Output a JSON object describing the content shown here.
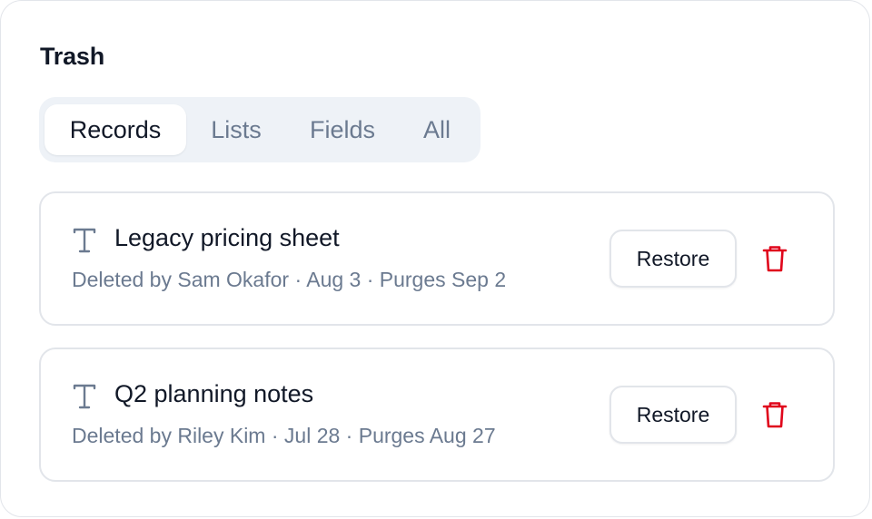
{
  "panel": {
    "title": "Trash"
  },
  "tabs": [
    {
      "label": "Records",
      "active": true
    },
    {
      "label": "Lists",
      "active": false
    },
    {
      "label": "Fields",
      "active": false
    },
    {
      "label": "All",
      "active": false
    }
  ],
  "items": [
    {
      "type_icon": "text-type-icon",
      "title": "Legacy pricing sheet",
      "meta": "Deleted by Sam Okafor · Aug 3 · Purges Sep 2",
      "restore_label": "Restore",
      "delete_icon": "trash-icon"
    },
    {
      "type_icon": "text-type-icon",
      "title": "Q2 planning notes",
      "meta": "Deleted by Riley Kim · Jul 28 · Purges Aug 27",
      "restore_label": "Restore",
      "delete_icon": "trash-icon"
    }
  ],
  "colors": {
    "text_primary": "#111827",
    "text_muted": "#6b7a90",
    "tab_track": "#eef2f7",
    "border": "#e2e5ea",
    "danger": "#e0061c"
  }
}
